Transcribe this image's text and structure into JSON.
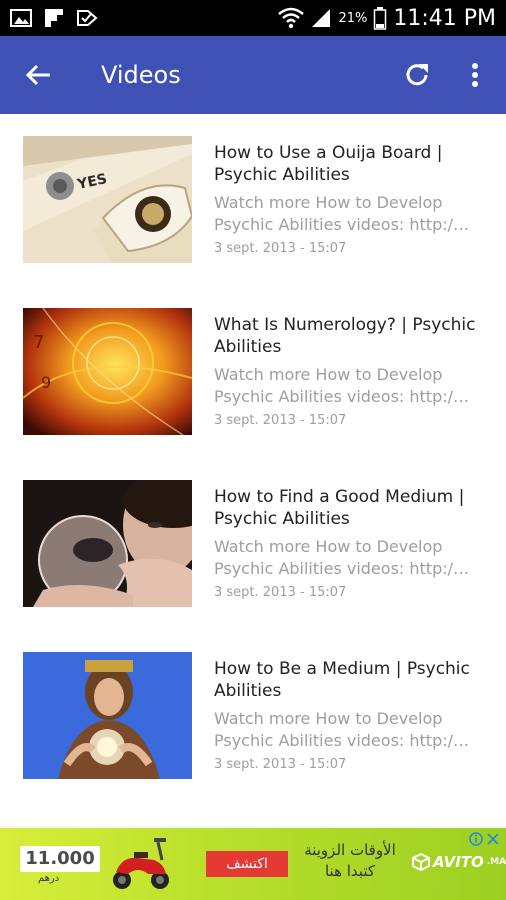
{
  "status_bar": {
    "battery_percent": "21%",
    "time": "11:41 PM"
  },
  "app_bar": {
    "title": "Videos",
    "color": "#3f51b5"
  },
  "videos": [
    {
      "title": "How to Use a Ouija Board | Psychic Abilities",
      "desc_line1": "Watch more How to Develop",
      "desc_line2": "Psychic Abilities videos: http:/…",
      "date": "3 sept. 2013 - 15:07",
      "thumbnail_text": "YES"
    },
    {
      "title": "What Is Numerology? | Psychic Abilities",
      "desc_line1": "Watch more How to Develop",
      "desc_line2": "Psychic Abilities videos: http:/…",
      "date": "3 sept. 2013 - 15:07"
    },
    {
      "title": "How to Find a Good Medium | Psychic Abilities",
      "desc_line1": "Watch more How to Develop",
      "desc_line2": "Psychic Abilities videos: http:/…",
      "date": "3 sept. 2013 - 15:07"
    },
    {
      "title": "How to Be a Medium | Psychic Abilities",
      "desc_line1": "Watch more How to Develop",
      "desc_line2": "Psychic Abilities videos: http:/…",
      "date": "3 sept. 2013 - 15:07"
    }
  ],
  "ad": {
    "price": "11.000",
    "currency": "درهم",
    "cta": "اكتشف",
    "headline": "الأوقات الزوينة",
    "subline": "كتبدا هنا",
    "brand": "AVITO",
    "brand_tld": ".MA"
  }
}
